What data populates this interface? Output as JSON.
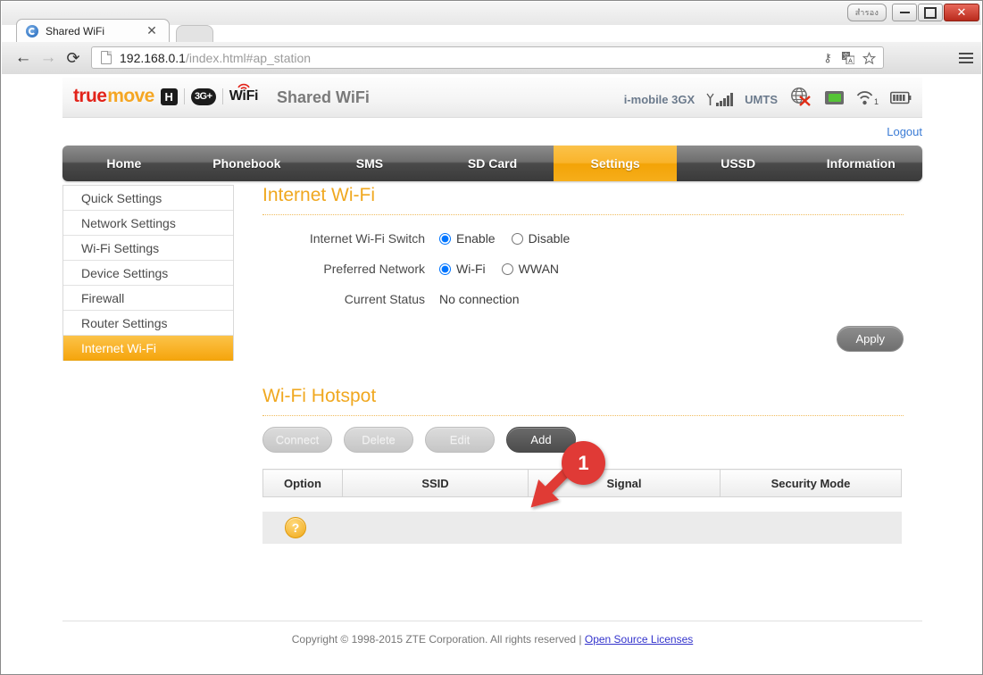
{
  "browser": {
    "window_controls": {
      "thai_label": "สำรอง",
      "minimize": "−",
      "maximize": "□",
      "close": "✕"
    },
    "tab": {
      "title": "Shared WiFi",
      "close_label": "✕"
    },
    "toolbar": {
      "back": "←",
      "forward": "→",
      "reload": "⟳",
      "url_host": "192.168.0.1",
      "url_path": "/index.html#ap_station",
      "url_full": "192.168.0.1/index.html#ap_station"
    },
    "omnibox_icons": [
      "key-icon",
      "translate-icon",
      "bookmark-star-icon"
    ],
    "menu_label": "☰"
  },
  "header": {
    "logo": {
      "true": "true",
      "move": "move",
      "h_badge": "H",
      "g3_badge": "3G+",
      "wifi": "WiFi"
    },
    "title": "Shared WiFi",
    "status": {
      "carrier": "i-mobile 3GX",
      "network_type": "UMTS",
      "signal_bars": 5,
      "wifi_clients": "1",
      "battery_bars": 4,
      "internet_icon": "globe-disconnected-icon",
      "sdcard_icon": "sd-card-icon"
    },
    "logout": "Logout"
  },
  "nav": {
    "tabs": [
      {
        "label": "Home",
        "active": false
      },
      {
        "label": "Phonebook",
        "active": false
      },
      {
        "label": "SMS",
        "active": false
      },
      {
        "label": "SD Card",
        "active": false
      },
      {
        "label": "Settings",
        "active": true
      },
      {
        "label": "USSD",
        "active": false
      },
      {
        "label": "Information",
        "active": false
      }
    ]
  },
  "sidebar": {
    "items": [
      {
        "label": "Quick Settings",
        "active": false
      },
      {
        "label": "Network Settings",
        "active": false
      },
      {
        "label": "Wi-Fi Settings",
        "active": false
      },
      {
        "label": "Device Settings",
        "active": false
      },
      {
        "label": "Firewall",
        "active": false
      },
      {
        "label": "Router Settings",
        "active": false
      },
      {
        "label": "Internet Wi-Fi",
        "active": true
      }
    ]
  },
  "internet_wifi": {
    "section_title": "Internet Wi-Fi",
    "switch_label": "Internet Wi-Fi Switch",
    "switch_options": [
      "Enable",
      "Disable"
    ],
    "switch_selected": "Enable",
    "preferred_label": "Preferred Network",
    "preferred_options": [
      "Wi-Fi",
      "WWAN"
    ],
    "preferred_selected": "Wi-Fi",
    "status_label": "Current Status",
    "status_value": "No connection",
    "apply_label": "Apply"
  },
  "hotspot": {
    "section_title": "Wi-Fi Hotspot",
    "buttons": [
      {
        "label": "Connect",
        "enabled": false
      },
      {
        "label": "Delete",
        "enabled": false
      },
      {
        "label": "Edit",
        "enabled": false
      },
      {
        "label": "Add",
        "enabled": true
      }
    ],
    "table_headers": [
      "Option",
      "SSID",
      "Signal",
      "Security Mode"
    ],
    "rows": [],
    "help_icon": "?"
  },
  "footer": {
    "copyright": "Copyright © 1998-2015 ZTE Corporation. All rights reserved  |  ",
    "link": "Open Source Licenses"
  },
  "annotation": {
    "step_number": "1",
    "points_to": "Add"
  },
  "colors": {
    "accent_orange": "#f5a50d",
    "brand_red": "#e2231a",
    "brand_orange": "#f5a623",
    "annotation_red": "#e03a36",
    "link_blue": "#3a7bd5"
  }
}
